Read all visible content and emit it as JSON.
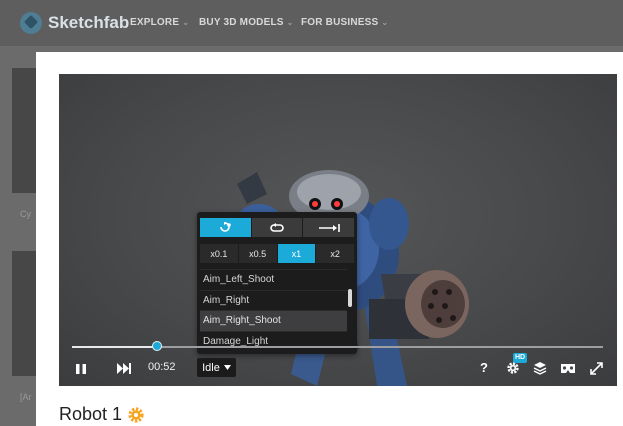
{
  "header": {
    "logo_text": "Sketchfab",
    "nav": [
      {
        "label": "EXPLORE"
      },
      {
        "label": "BUY 3D MODELS"
      },
      {
        "label": "FOR BUSINESS"
      }
    ]
  },
  "background": {
    "card1_caption": "Cy",
    "card2_caption": "[Ar"
  },
  "viewer": {
    "progress": 0.16,
    "time": "00:52",
    "animation_selector_label": "Idle",
    "hd_badge": "HD",
    "popup": {
      "modes": [
        {
          "icon": "loop-all-icon",
          "active": true
        },
        {
          "icon": "loop-one-icon",
          "active": false
        },
        {
          "icon": "play-once-icon",
          "active": false
        }
      ],
      "speeds": [
        {
          "label": "x0.1",
          "active": false
        },
        {
          "label": "x0.5",
          "active": false
        },
        {
          "label": "x1",
          "active": true
        },
        {
          "label": "x2",
          "active": false
        }
      ],
      "animations": [
        {
          "label": "Aim_Left_Shoot",
          "active": false
        },
        {
          "label": "Aim_Right",
          "active": false
        },
        {
          "label": "Aim_Right_Shoot",
          "active": true
        },
        {
          "label": "Damage_Light",
          "active": false
        }
      ]
    },
    "controls_right": [
      "help-icon",
      "settings-icon",
      "layers-icon",
      "vr-icon",
      "fullscreen-icon"
    ],
    "help_label": "?"
  },
  "model": {
    "title": "Robot 1",
    "badge_icon": "staff-pick-gear-icon"
  },
  "colors": {
    "accent": "#1caad9",
    "badge": "#f5a623"
  }
}
